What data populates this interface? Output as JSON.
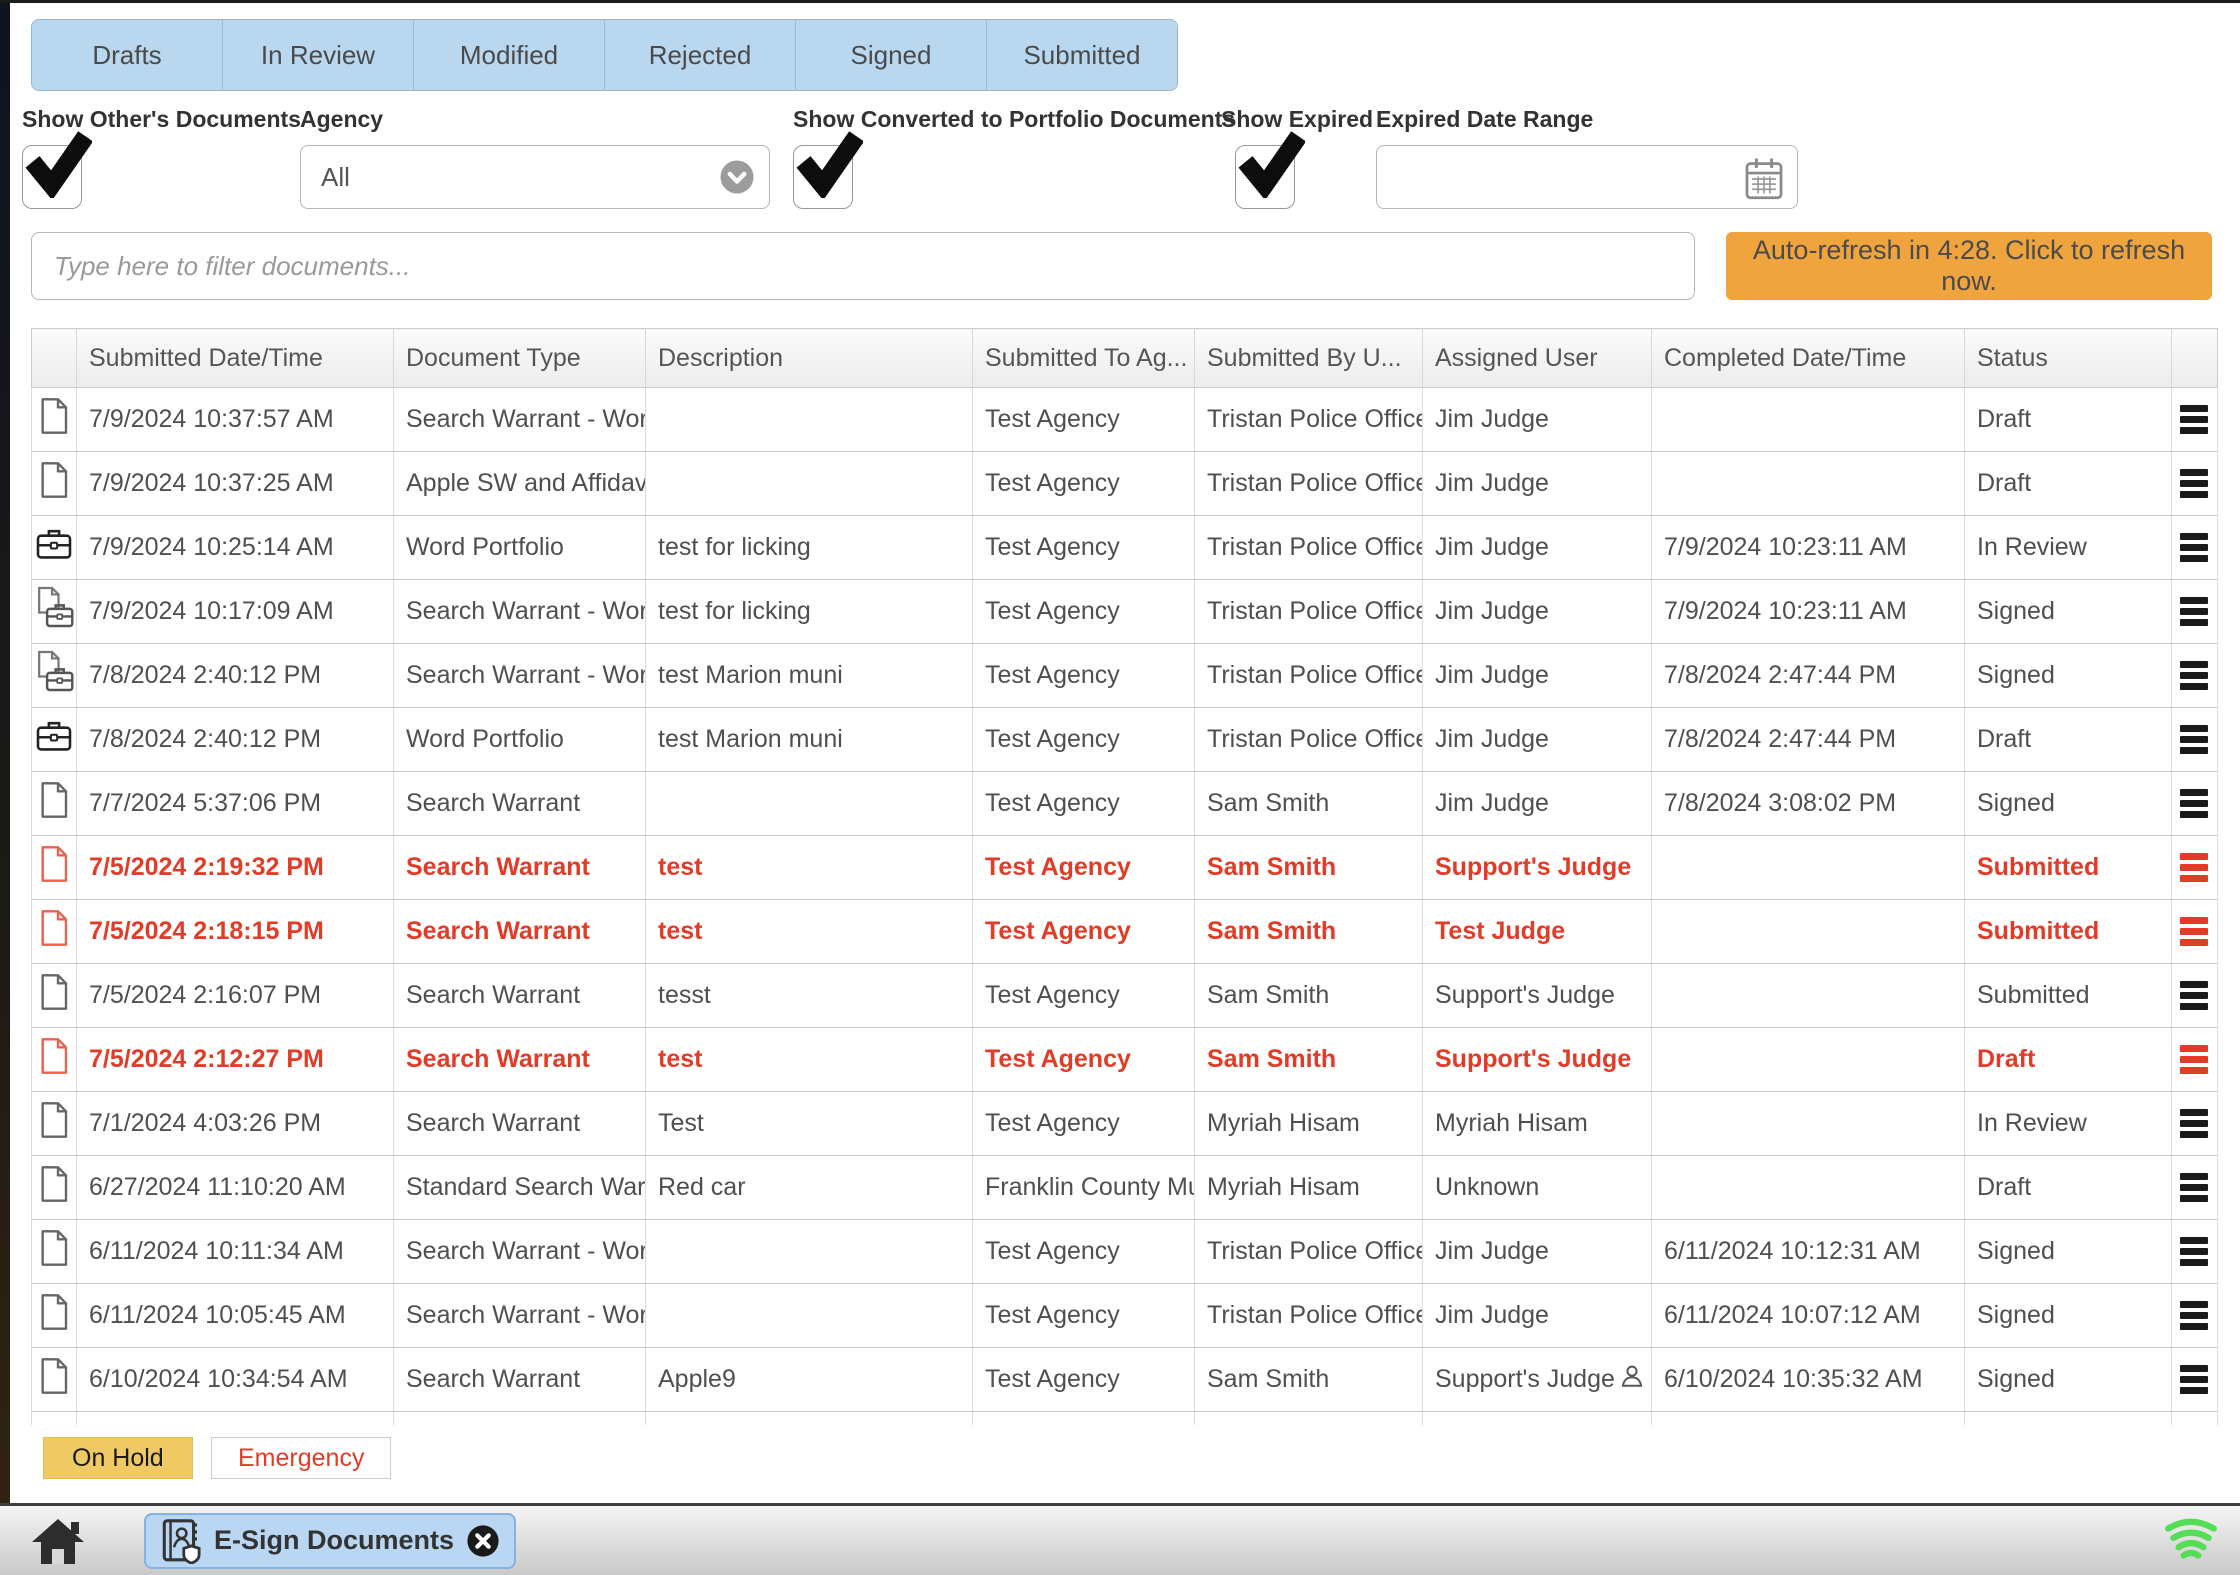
{
  "tabs": [
    {
      "label": "Drafts"
    },
    {
      "label": "In Review"
    },
    {
      "label": "Modified"
    },
    {
      "label": "Rejected"
    },
    {
      "label": "Signed"
    },
    {
      "label": "Submitted"
    }
  ],
  "filters": {
    "show_others_label": "Show Other's Documents",
    "show_others_checked": true,
    "agency_label": "Agency",
    "agency_value": "All",
    "show_converted_label": "Show Converted to Portfolio Documents",
    "show_converted_checked": true,
    "show_expired_label": "Show Expired",
    "show_expired_checked": true,
    "expired_range_label": "Expired Date Range",
    "expired_range_value": ""
  },
  "search": {
    "placeholder": "Type here to filter documents..."
  },
  "refresh_button": {
    "label": "Auto-refresh in 4:28. Click to refresh now."
  },
  "table": {
    "columns": [
      "",
      "Submitted Date/Time",
      "Document Type",
      "Description",
      "Submitted To Ag...",
      "Submitted By U...",
      "Assigned User",
      "Completed Date/Time",
      "Status",
      ""
    ],
    "rows": [
      {
        "icon": "document",
        "submitted": "7/9/2024 10:37:57 AM",
        "type": "Search Warrant - Wor",
        "desc": "",
        "to": "Test Agency",
        "by": "Tristan Police Office",
        "assigned": "Jim Judge",
        "assigned_icon": false,
        "completed": "",
        "status": "Draft",
        "red": false
      },
      {
        "icon": "document",
        "submitted": "7/9/2024 10:37:25 AM",
        "type": "Apple SW and Affidav",
        "desc": "",
        "to": "Test Agency",
        "by": "Tristan Police Office",
        "assigned": "Jim Judge",
        "assigned_icon": false,
        "completed": "",
        "status": "Draft",
        "red": false
      },
      {
        "icon": "portfolio",
        "submitted": "7/9/2024 10:25:14 AM",
        "type": "Word Portfolio",
        "desc": "test for licking",
        "to": "Test Agency",
        "by": "Tristan Police Office",
        "assigned": "Jim Judge",
        "assigned_icon": false,
        "completed": "7/9/2024 10:23:11 AM",
        "status": "In Review",
        "red": false
      },
      {
        "icon": "document-portfolio",
        "submitted": "7/9/2024 10:17:09 AM",
        "type": "Search Warrant - Wor",
        "desc": "test for licking",
        "to": "Test Agency",
        "by": "Tristan Police Office",
        "assigned": "Jim Judge",
        "assigned_icon": false,
        "completed": "7/9/2024 10:23:11 AM",
        "status": "Signed",
        "red": false
      },
      {
        "icon": "document-portfolio",
        "submitted": "7/8/2024 2:40:12 PM",
        "type": "Search Warrant - Wor",
        "desc": "test Marion muni",
        "to": "Test Agency",
        "by": "Tristan Police Office",
        "assigned": "Jim Judge",
        "assigned_icon": false,
        "completed": "7/8/2024 2:47:44 PM",
        "status": "Signed",
        "red": false
      },
      {
        "icon": "portfolio",
        "submitted": "7/8/2024 2:40:12 PM",
        "type": "Word Portfolio",
        "desc": "test Marion muni",
        "to": "Test Agency",
        "by": "Tristan Police Office",
        "assigned": "Jim Judge",
        "assigned_icon": false,
        "completed": "7/8/2024 2:47:44 PM",
        "status": "Draft",
        "red": false
      },
      {
        "icon": "document",
        "submitted": "7/7/2024 5:37:06 PM",
        "type": "Search Warrant",
        "desc": "",
        "to": "Test Agency",
        "by": "Sam Smith",
        "assigned": "Jim Judge",
        "assigned_icon": false,
        "completed": "7/8/2024 3:08:02 PM",
        "status": "Signed",
        "red": false
      },
      {
        "icon": "document",
        "submitted": "7/5/2024 2:19:32 PM",
        "type": "Search Warrant",
        "desc": "test",
        "to": "Test Agency",
        "by": "Sam Smith",
        "assigned": "Support's Judge",
        "assigned_icon": false,
        "completed": "",
        "status": "Submitted",
        "red": true
      },
      {
        "icon": "document",
        "submitted": "7/5/2024 2:18:15 PM",
        "type": "Search Warrant",
        "desc": "test",
        "to": "Test Agency",
        "by": "Sam Smith",
        "assigned": "Test Judge",
        "assigned_icon": false,
        "completed": "",
        "status": "Submitted",
        "red": true
      },
      {
        "icon": "document",
        "submitted": "7/5/2024 2:16:07 PM",
        "type": "Search Warrant",
        "desc": "tesst",
        "to": "Test Agency",
        "by": "Sam Smith",
        "assigned": "Support's Judge",
        "assigned_icon": false,
        "completed": "",
        "status": "Submitted",
        "red": false
      },
      {
        "icon": "document",
        "submitted": "7/5/2024 2:12:27 PM",
        "type": "Search Warrant",
        "desc": "test",
        "to": "Test Agency",
        "by": "Sam Smith",
        "assigned": "Support's Judge",
        "assigned_icon": false,
        "completed": "",
        "status": "Draft",
        "red": true
      },
      {
        "icon": "document",
        "submitted": "7/1/2024 4:03:26 PM",
        "type": "Search Warrant",
        "desc": "Test",
        "to": "Test Agency",
        "by": "Myriah Hisam",
        "assigned": "Myriah Hisam",
        "assigned_icon": false,
        "completed": "",
        "status": "In Review",
        "red": false
      },
      {
        "icon": "document",
        "submitted": "6/27/2024 11:10:20 AM",
        "type": "Standard Search War",
        "desc": "Red car",
        "to": "Franklin County Mu",
        "by": "Myriah Hisam",
        "assigned": "Unknown",
        "assigned_icon": false,
        "completed": "",
        "status": "Draft",
        "red": false
      },
      {
        "icon": "document",
        "submitted": "6/11/2024 10:11:34 AM",
        "type": "Search Warrant - Wor",
        "desc": "",
        "to": "Test Agency",
        "by": "Tristan Police Office",
        "assigned": "Jim Judge",
        "assigned_icon": false,
        "completed": "6/11/2024 10:12:31 AM",
        "status": "Signed",
        "red": false
      },
      {
        "icon": "document",
        "submitted": "6/11/2024 10:05:45 AM",
        "type": "Search Warrant - Wor",
        "desc": "",
        "to": "Test Agency",
        "by": "Tristan Police Office",
        "assigned": "Jim Judge",
        "assigned_icon": false,
        "completed": "6/11/2024 10:07:12 AM",
        "status": "Signed",
        "red": false
      },
      {
        "icon": "document",
        "submitted": "6/10/2024 10:34:54 AM",
        "type": "Search Warrant",
        "desc": "Apple9",
        "to": "Test Agency",
        "by": "Sam Smith",
        "assigned": "Support's Judge",
        "assigned_icon": true,
        "completed": "6/10/2024 10:35:32 AM",
        "status": "Signed",
        "red": false
      }
    ],
    "has_partial_last_row": true
  },
  "footer_buttons": {
    "on_hold": "On Hold",
    "emergency": "Emergency"
  },
  "taskbar": {
    "tab_label": "E-Sign Documents"
  },
  "colors": {
    "red": "#e23c29",
    "refresh_orange": "#f0a43e",
    "on_hold_amber": "#efc964",
    "tab_blue": "#b9d8ef",
    "wifi_green": "#55dd55"
  }
}
